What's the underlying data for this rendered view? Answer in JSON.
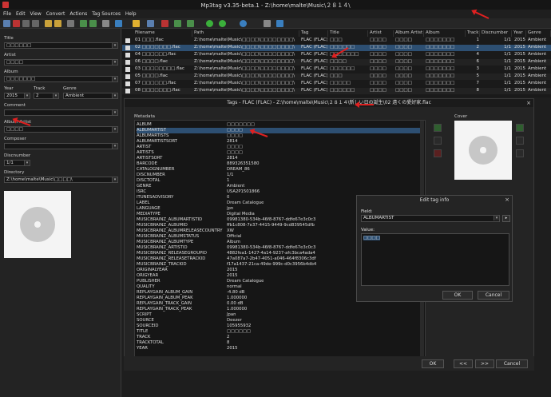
{
  "window": {
    "title": "Mp3tag v3.35-beta.1 - Z:\\home\\malte\\Music\\２８１４\\"
  },
  "menu": [
    "File",
    "Edit",
    "View",
    "Convert",
    "Actions",
    "Tag Sources",
    "Help"
  ],
  "left": {
    "fields": [
      {
        "label": "Title",
        "value": "□□□□□□"
      },
      {
        "label": "Artist",
        "value": "□□□□"
      },
      {
        "label": "Album",
        "value": "□□□□□□□"
      },
      {
        "label": "Year",
        "value": "2015"
      },
      {
        "label": "Track",
        "value": "2"
      },
      {
        "label": "Genre",
        "value": "Ambient"
      },
      {
        "label": "Comment",
        "value": ""
      },
      {
        "label": "Album Artist",
        "value": "□□□□"
      },
      {
        "label": "Composer",
        "value": ""
      },
      {
        "label": "Discnumber",
        "value": "1/1"
      },
      {
        "label": "Directory",
        "value": "Z:\\home\\malte\\Music\\□□□□\\"
      }
    ]
  },
  "filelist": {
    "headers": [
      "Filename",
      "Path",
      "Tag",
      "Title",
      "Artist",
      "Album Artist",
      "Album",
      "Track",
      "Discnumber",
      "Year",
      "Genre"
    ],
    "rows": [
      [
        "01 □□□.flac",
        "Z:\\home\\malte\\Music\\□□□□\\□□□□□□□□\\",
        "FLAC (FLAC)",
        "□□□",
        "□□□□",
        "□□□□",
        "□□□□□□□",
        "1",
        "1/1",
        "2015",
        "Ambient"
      ],
      [
        "02 □□□□□□□.flac",
        "Z:\\home\\malte\\Music\\□□□□\\□□□□□□□□\\",
        "FLAC (FLAC)",
        "□□□□□□",
        "□□□□",
        "□□□□",
        "□□□□□□□",
        "2",
        "1/1",
        "2015",
        "Ambient"
      ],
      [
        "04 □□□□□□.flac",
        "Z:\\home\\malte\\Music\\□□□□\\□□□□□□□□\\",
        "FLAC (FLAC)",
        "□□□□□□□",
        "□□□□",
        "□□□□",
        "□□□□□□□",
        "4",
        "1/1",
        "2015",
        "Ambient"
      ],
      [
        "06 □□□□.flac",
        "Z:\\home\\malte\\Music\\□□□□\\□□□□□□□□\\",
        "FLAC (FLAC)",
        "□□□□",
        "□□□□",
        "□□□□",
        "□□□□□□□",
        "6",
        "1/1",
        "2015",
        "Ambient"
      ],
      [
        "03 □□□□□□□□.flac",
        "Z:\\home\\malte\\Music\\□□□□\\□□□□□□□□\\",
        "FLAC (FLAC)",
        "□□□□□□",
        "□□□□",
        "□□□□",
        "□□□□□□□",
        "3",
        "1/1",
        "2015",
        "Ambient"
      ],
      [
        "05 □□□□.flac",
        "Z:\\home\\malte\\Music\\□□□□\\□□□□□□□□\\",
        "FLAC (FLAC)",
        "□□□",
        "□□□□",
        "□□□□",
        "□□□□□□□",
        "5",
        "1/1",
        "2015",
        "Ambient"
      ],
      [
        "07 □□□□□□.flac",
        "Z:\\home\\malte\\Music\\□□□□\\□□□□□□□□\\",
        "FLAC (FLAC)",
        "□□□□□",
        "□□□□",
        "□□□□",
        "□□□□□□□",
        "7",
        "1/1",
        "2015",
        "Ambient"
      ],
      [
        "08 □□□□□□□.flac",
        "Z:\\home\\malte\\Music\\□□□□\\□□□□□□□□\\",
        "FLAC (FLAC)",
        "□□□□□□",
        "□□□□",
        "□□□□",
        "□□□□□□□",
        "8",
        "1/1",
        "2015",
        "Ambient"
      ]
    ]
  },
  "dialog": {
    "title": "Tags - FLAC (FLAC) - Z:\\home\\malte\\Music\\２８１４\\新しい日の誕生\\02 遠くの愛好家.flac",
    "metadata_label": "Metadata",
    "cover_label": "Cover",
    "rows": [
      [
        "ALBUM",
        "□□□□□□□"
      ],
      [
        "ALBUMARTIST",
        "□□□□"
      ],
      [
        "ALBUMARTISTS",
        "□□□□"
      ],
      [
        "ALBUMARTISTSORT",
        "2814"
      ],
      [
        "ARTIST",
        "□□□□"
      ],
      [
        "ARTISTS",
        "□□□□"
      ],
      [
        "ARTISTSORT",
        "2814"
      ],
      [
        "BARCODE",
        "889326351580"
      ],
      [
        "CATALOGNUMBER",
        "DREAM_86"
      ],
      [
        "DISCNUMBER",
        "1/1"
      ],
      [
        "DISCTOTAL",
        "1"
      ],
      [
        "GENRE",
        "Ambient"
      ],
      [
        "ISRC",
        "USA2P1501866"
      ],
      [
        "ITUNESADVISORY",
        "0"
      ],
      [
        "LABEL",
        "Dream Catalogue"
      ],
      [
        "LANGUAGE",
        "jpn"
      ],
      [
        "MEDIATYPE",
        "Digital Media"
      ],
      [
        "MUSICBRAINZ_ALBUMARTISTID",
        "09981380-534b-46f8-8767-ddfe67e3c0c3"
      ],
      [
        "MUSICBRAINZ_ALBUMID",
        "ffb1c808-7e37-4415-9449-9cd839545dfb"
      ],
      [
        "MUSICBRAINZ_ALBUMRELEASECOUNTRY",
        "XW"
      ],
      [
        "MUSICBRAINZ_ALBUMSTATUS",
        "Official"
      ],
      [
        "MUSICBRAINZ_ALBUMTYPE",
        "Album"
      ],
      [
        "MUSICBRAINZ_ARTISTID",
        "09981380-534b-46f8-8767-ddfe67e3c0c3"
      ],
      [
        "MUSICBRAINZ_RELEASEGROUPID",
        "4882fea1-1427-4a14-9237-afc3bca4ada4"
      ],
      [
        "MUSICBRAINZ_RELEASETRACKID",
        "47a087a7-2b47-4051-a046-464f8306c3df"
      ],
      [
        "MUSICBRAINZ_TRACKID",
        "f17a1437-21ca-49de-999c-d0c3956b4db4"
      ],
      [
        "ORIGINALYEAR",
        "2015"
      ],
      [
        "ORIGYEAR",
        "2015"
      ],
      [
        "PUBLISHER",
        "Dream Catalogue"
      ],
      [
        "QUALITY",
        "normal"
      ],
      [
        "REPLAYGAIN_ALBUM_GAIN",
        "-4.80 dB"
      ],
      [
        "REPLAYGAIN_ALBUM_PEAK",
        "1.000000"
      ],
      [
        "REPLAYGAIN_TRACK_GAIN",
        "0.00 dB"
      ],
      [
        "REPLAYGAIN_TRACK_PEAK",
        "1.000000"
      ],
      [
        "SCRIPT",
        "Jpan"
      ],
      [
        "SOURCE",
        "Deezer"
      ],
      [
        "SOURCEID",
        "105955932"
      ],
      [
        "TITLE",
        "□□□□□□"
      ],
      [
        "TRACK",
        "2"
      ],
      [
        "TRACKTOTAL",
        "8"
      ],
      [
        "YEAR",
        "2015"
      ]
    ],
    "ok": "OK",
    "prev": "<<",
    "next": ">>",
    "cancel": "Cancel"
  },
  "edit": {
    "title": "Edit tag info",
    "field_label": "Field:",
    "field_value": "ALBUMARTIST",
    "value_label": "Value:",
    "value": "□□□□",
    "ok": "OK",
    "cancel": "Cancel"
  }
}
